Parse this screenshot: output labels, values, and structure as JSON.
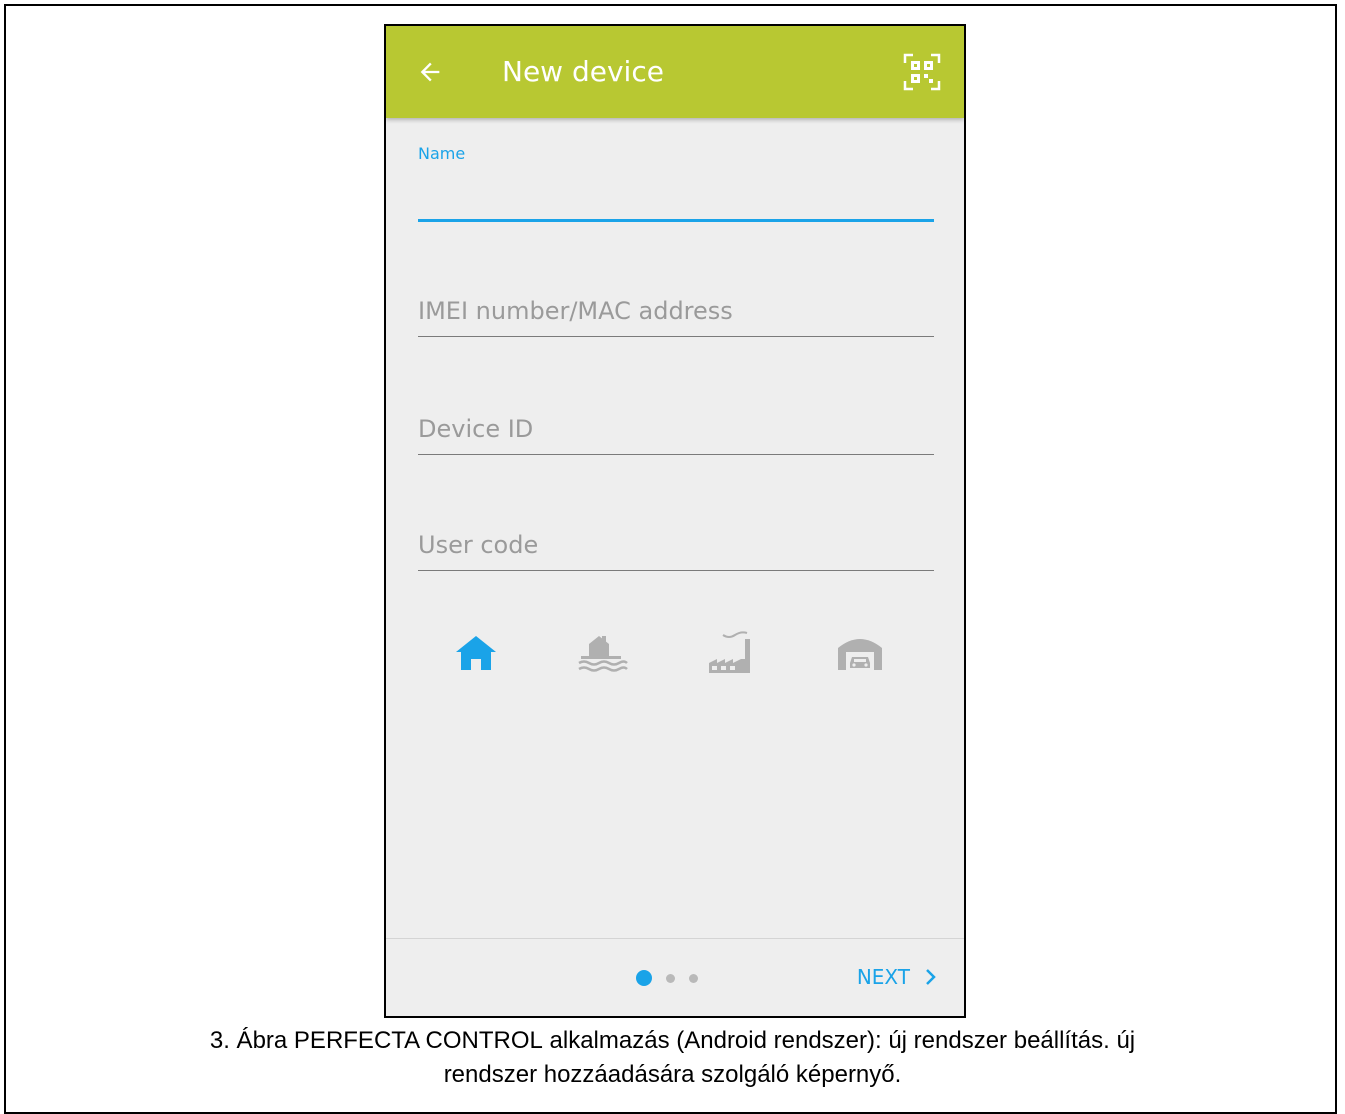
{
  "appbar": {
    "title": "New device",
    "background": "#b8c832",
    "back_icon": "arrow-left-icon",
    "qr_icon": "qr-code-scan-icon"
  },
  "form": {
    "name": {
      "label": "Name",
      "value": ""
    },
    "imei": {
      "placeholder": "IMEI number/MAC address",
      "value": ""
    },
    "device_id": {
      "placeholder": "Device ID",
      "value": ""
    },
    "user_code": {
      "placeholder": "User code",
      "value": ""
    }
  },
  "object_types": [
    {
      "icon": "home-icon",
      "selected": true
    },
    {
      "icon": "lakeside-house-icon",
      "selected": false
    },
    {
      "icon": "factory-icon",
      "selected": false
    },
    {
      "icon": "garage-icon",
      "selected": false
    }
  ],
  "pager": {
    "total": 3,
    "current": 1
  },
  "footer": {
    "next_label": "NEXT",
    "next_icon": "chevron-right-icon"
  },
  "caption": {
    "prefix": "3. Ábra PERFECTA C",
    "smallcaps": "ONTROL",
    "line1_rest": " alkalmazás (Android rendszer): új rendszer beállítás. új",
    "line2": "rendszer hozzáadására szolgáló képernyő."
  },
  "colors": {
    "accent": "#1aa3e8",
    "inactive_icon": "#b0b0b0",
    "screen_bg": "#eeeeee"
  }
}
